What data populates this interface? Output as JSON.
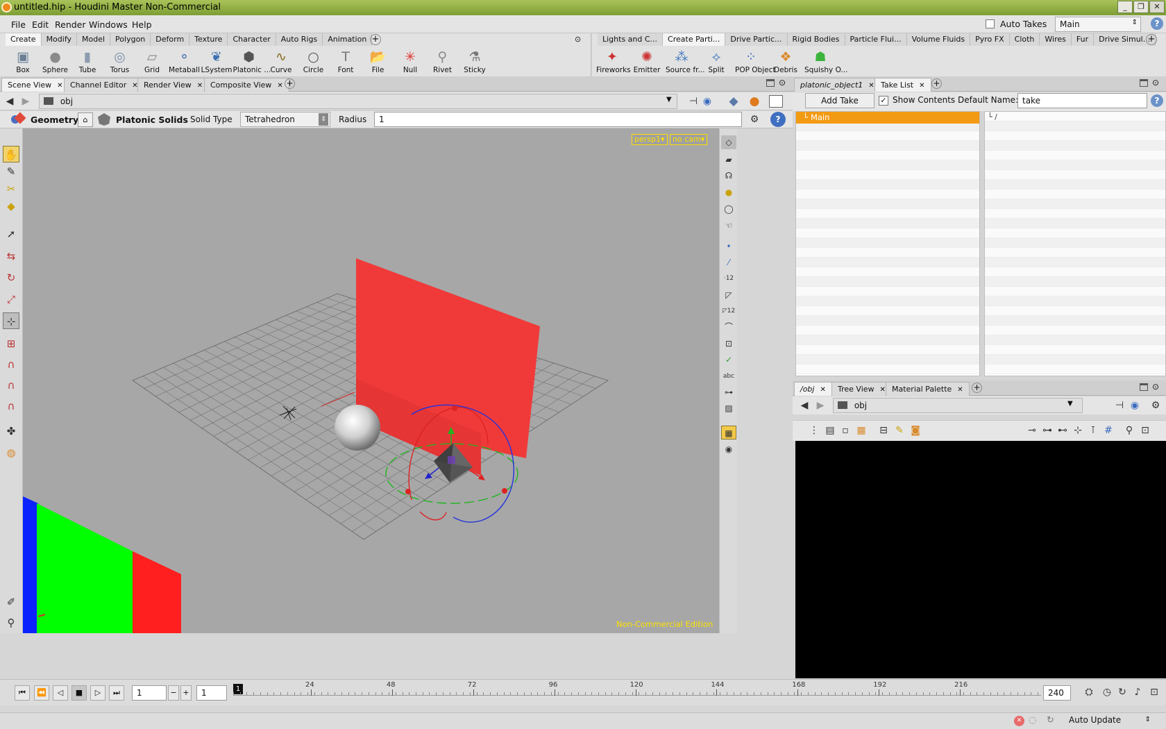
{
  "window": {
    "title": "untitled.hip - Houdini Master Non-Commercial"
  },
  "menu": [
    "File",
    "Edit",
    "Render",
    "Windows",
    "Help"
  ],
  "auto_takes": {
    "label": "Auto Takes",
    "checked": false
  },
  "desktop": {
    "value": "Main"
  },
  "shelf_left": {
    "tabs": [
      "Create",
      "Modify",
      "Model",
      "Polygon",
      "Deform",
      "Texture",
      "Character",
      "Auto Rigs",
      "Animation"
    ],
    "active_tab": "Create",
    "tools": [
      {
        "label": "Box",
        "icon": "box-icon",
        "glyph": "▣",
        "color": "#6a7f96"
      },
      {
        "label": "Sphere",
        "icon": "sphere-icon",
        "glyph": "●",
        "color": "#8a8a8a"
      },
      {
        "label": "Tube",
        "icon": "tube-icon",
        "glyph": "▮",
        "color": "#8c9bb0"
      },
      {
        "label": "Torus",
        "icon": "torus-icon",
        "glyph": "◎",
        "color": "#7a8ea6"
      },
      {
        "label": "Grid",
        "icon": "grid-icon",
        "glyph": "▱",
        "color": "#8a8a8a"
      },
      {
        "label": "Metaball",
        "icon": "metaball-icon",
        "glyph": "⚬",
        "color": "#4b73b8"
      },
      {
        "label": "LSystem",
        "icon": "lsystem-icon",
        "glyph": "❦",
        "color": "#3c6fb0"
      },
      {
        "label": "Platonic ...",
        "icon": "platonic-icon",
        "glyph": "⬢",
        "color": "#555"
      },
      {
        "label": "Curve",
        "icon": "curve-icon",
        "glyph": "∿",
        "color": "#8a6a20"
      },
      {
        "label": "Circle",
        "icon": "circle-icon",
        "glyph": "○",
        "color": "#555"
      },
      {
        "label": "Font",
        "icon": "font-icon",
        "glyph": "T",
        "color": "#777"
      },
      {
        "label": "File",
        "icon": "file-icon",
        "glyph": "📂",
        "color": "#d98a2b"
      },
      {
        "label": "Null",
        "icon": "null-icon",
        "glyph": "✳",
        "color": "#d33"
      },
      {
        "label": "Rivet",
        "icon": "rivet-icon",
        "glyph": "⚲",
        "color": "#888"
      },
      {
        "label": "Sticky",
        "icon": "sticky-icon",
        "glyph": "⚗",
        "color": "#777"
      }
    ]
  },
  "shelf_right": {
    "tabs": [
      "Lights and C...",
      "Create Parti...",
      "Drive Partic...",
      "Rigid Bodies",
      "Particle Flui...",
      "Volume Fluids",
      "Pyro FX",
      "Cloth",
      "Wires",
      "Fur",
      "Drive Simul..."
    ],
    "active_tab": "Create Parti...",
    "tools": [
      {
        "label": "Fireworks",
        "icon": "fireworks-icon",
        "glyph": "✦",
        "color": "#c33"
      },
      {
        "label": "Emitter",
        "icon": "emitter-icon",
        "glyph": "✺",
        "color": "#c33"
      },
      {
        "label": "Source fr...",
        "icon": "source-icon",
        "glyph": "⁂",
        "color": "#4a7fc0"
      },
      {
        "label": "Split",
        "icon": "split-icon",
        "glyph": "⟡",
        "color": "#4a7fc0"
      },
      {
        "label": "POP Object",
        "icon": "pop-object-icon",
        "glyph": "⁘",
        "color": "#3a6cc0"
      },
      {
        "label": "Debris",
        "icon": "debris-icon",
        "glyph": "❖",
        "color": "#d98a2b"
      },
      {
        "label": "Squishy O...",
        "icon": "squishy-icon",
        "glyph": "☗",
        "color": "#3cb43c"
      }
    ]
  },
  "scene_tabs": [
    "Scene View",
    "Channel Editor",
    "Render View",
    "Composite View"
  ],
  "scene_path": "obj",
  "op_toolbar": {
    "context": "Geometry",
    "node_type": "Platonic Solids",
    "solid_type_label": "Solid Type",
    "solid_type_value": "Tetrahedron",
    "radius_label": "Radius",
    "radius_value": "1"
  },
  "viewport": {
    "camera": "persp1",
    "cam_menu": "no cam",
    "watermark": "Non-Commercial Edition"
  },
  "takes_pane": {
    "tabs": [
      "platonic_object1",
      "Take List"
    ],
    "add_take": "Add Take",
    "show_contents": "Show Contents",
    "show_contents_checked": true,
    "default_name_label": "Default Name:",
    "default_name_value": "take",
    "takes": [
      "Main"
    ],
    "contents_root": "/"
  },
  "network_pane": {
    "tabs": [
      "/obj",
      "Tree View",
      "Material Palette"
    ],
    "path": "obj"
  },
  "timeline": {
    "current_frame": "1",
    "step": "1",
    "marker": "1",
    "ticks": [
      "24",
      "48",
      "72",
      "96",
      "120",
      "144",
      "168",
      "192",
      "216"
    ],
    "end_frame": "240"
  },
  "status": {
    "update_mode": "Auto Update"
  },
  "colors": {
    "accent": "#f39a13",
    "viewport_bg": "#a7a7a7",
    "warning": "#ffe000"
  }
}
